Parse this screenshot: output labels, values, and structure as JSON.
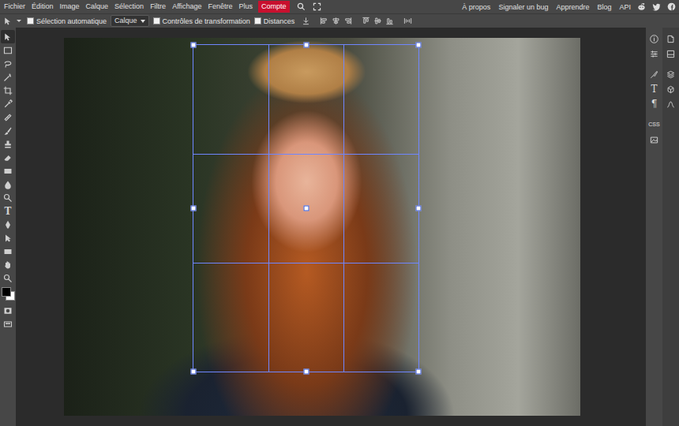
{
  "menu": [
    {
      "label": "Fichier",
      "highlighted": false
    },
    {
      "label": "Édition",
      "highlighted": false
    },
    {
      "label": "Image",
      "highlighted": false
    },
    {
      "label": "Calque",
      "highlighted": false
    },
    {
      "label": "Sélection",
      "highlighted": false
    },
    {
      "label": "Filtre",
      "highlighted": false
    },
    {
      "label": "Affichage",
      "highlighted": false
    },
    {
      "label": "Fenêtre",
      "highlighted": false
    },
    {
      "label": "Plus",
      "highlighted": false
    },
    {
      "label": "Compte",
      "highlighted": true
    }
  ],
  "links": [
    "À propos",
    "Signaler un bug",
    "Apprendre",
    "Blog",
    "API"
  ],
  "options_bar": {
    "auto_select": {
      "label": "Sélection automatique",
      "checked": false
    },
    "target": {
      "value": "Calque"
    },
    "transform_controls": {
      "label": "Contrôles de transformation",
      "checked": false
    },
    "distances": {
      "label": "Distances",
      "checked": false
    }
  },
  "tools": [
    {
      "kind": "svg",
      "selected": true
    },
    {
      "kind": "svg",
      "selected": false
    },
    {
      "kind": "svg",
      "selected": false
    },
    {
      "kind": "svg",
      "selected": false
    },
    {
      "kind": "svg",
      "selected": false
    },
    {
      "kind": "svg",
      "selected": false
    },
    {
      "kind": "svg",
      "selected": false
    },
    {
      "kind": "svg",
      "selected": false
    },
    {
      "kind": "svg",
      "selected": false
    },
    {
      "kind": "svg",
      "selected": false
    },
    {
      "kind": "svg",
      "selected": false
    },
    {
      "kind": "svg",
      "selected": false
    },
    {
      "kind": "svg",
      "selected": false
    },
    {
      "kind": "glyph",
      "glyph": "T",
      "selected": false
    },
    {
      "kind": "svg",
      "selected": false
    },
    {
      "kind": "svg",
      "selected": false
    },
    {
      "kind": "svg",
      "selected": false
    },
    {
      "kind": "svg",
      "selected": false
    },
    {
      "kind": "svg",
      "selected": false
    }
  ],
  "colors": {
    "foreground": "#000000",
    "background": "#ffffff"
  },
  "side_panel": [
    {
      "kind": "icon"
    },
    {
      "kind": "icon"
    },
    {
      "kind": "icon"
    },
    {
      "kind": "glyph",
      "glyph": "T"
    },
    {
      "kind": "glyph",
      "glyph": "¶"
    },
    {
      "kind": "text",
      "label": "CSS"
    },
    {
      "kind": "icon"
    }
  ]
}
